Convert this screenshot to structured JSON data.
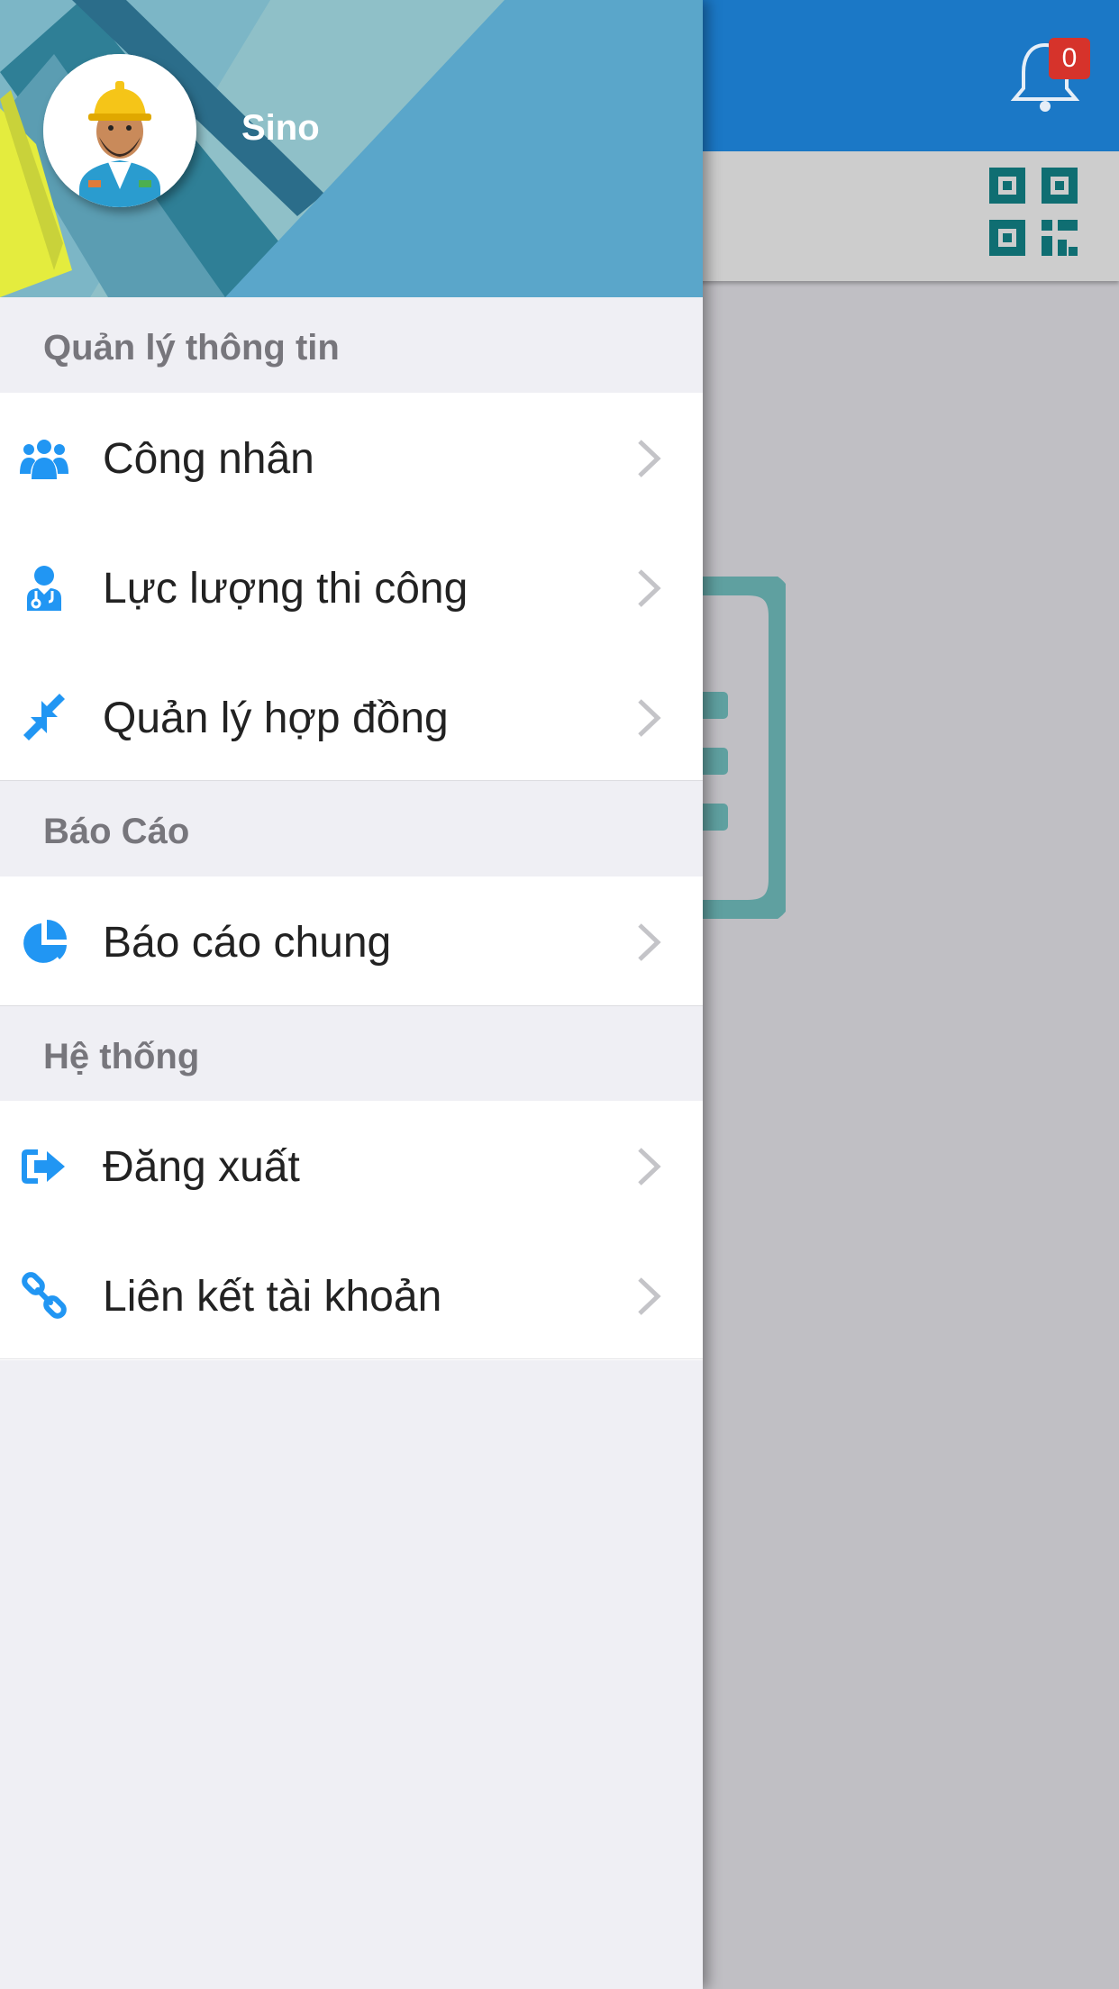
{
  "app": {
    "notification_count": "0"
  },
  "user": {
    "name": "Sino"
  },
  "sections": [
    {
      "title": "Quản lý thông tin",
      "items": [
        {
          "label": "Công nhân",
          "icon": "users-icon"
        },
        {
          "label": "Lực lượng thi công",
          "icon": "user-md-icon"
        },
        {
          "label": "Quản lý hợp đồng",
          "icon": "compress-icon"
        }
      ]
    },
    {
      "title": "Báo Cáo",
      "items": [
        {
          "label": "Báo cáo chung",
          "icon": "pie-chart-icon"
        }
      ]
    },
    {
      "title": "Hệ thống",
      "items": [
        {
          "label": "Đăng xuất",
          "icon": "sign-out-icon"
        },
        {
          "label": "Liên kết tài khoản",
          "icon": "link-icon"
        }
      ]
    }
  ],
  "colors": {
    "accent": "#1b78c6",
    "icon_blue": "#2196f3",
    "badge": "#d6332b",
    "qr": "#0f6e72"
  }
}
